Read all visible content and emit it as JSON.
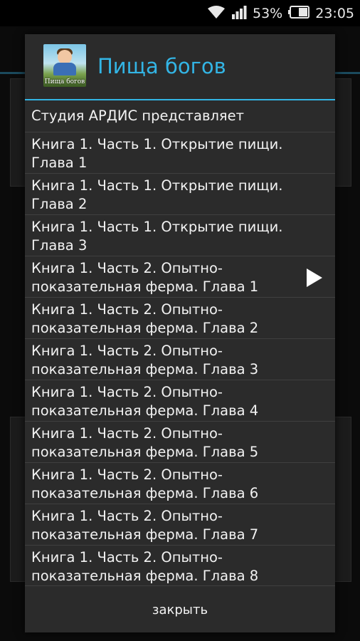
{
  "status_bar": {
    "battery": "53%",
    "time": "23:05"
  },
  "dialog": {
    "title": "Пища богов",
    "icon_caption": "Пища богов",
    "items": [
      {
        "label": "Студия АРДИС представляет"
      },
      {
        "label": "Книга 1. Часть 1. Открытие пищи. Глава 1"
      },
      {
        "label": "Книга 1. Часть 1. Открытие пищи. Глава 2"
      },
      {
        "label": "Книга 1. Часть 1. Открытие пищи. Глава 3"
      },
      {
        "label": "Книга 1. Часть 2. Опытно-показательная ферма. Глава 1",
        "playing": true
      },
      {
        "label": "Книга 1. Часть 2. Опытно-показательная ферма. Глава 2"
      },
      {
        "label": "Книга 1. Часть 2. Опытно-показательная ферма. Глава 3"
      },
      {
        "label": "Книга 1. Часть 2. Опытно-показательная ферма. Глава 4"
      },
      {
        "label": "Книга 1. Часть 2. Опытно-показательная ферма. Глава 5"
      },
      {
        "label": "Книга 1. Часть 2. Опытно-показательная ферма. Глава 6"
      },
      {
        "label": "Книга 1. Часть 2. Опытно-показательная ферма. Глава 7"
      },
      {
        "label": "Книга 1. Часть 2. Опытно-показательная ферма. Глава 8"
      }
    ],
    "close_label": "закрыть"
  },
  "colors": {
    "accent": "#33b5e5",
    "dialog_bg": "#2b2b2b"
  }
}
